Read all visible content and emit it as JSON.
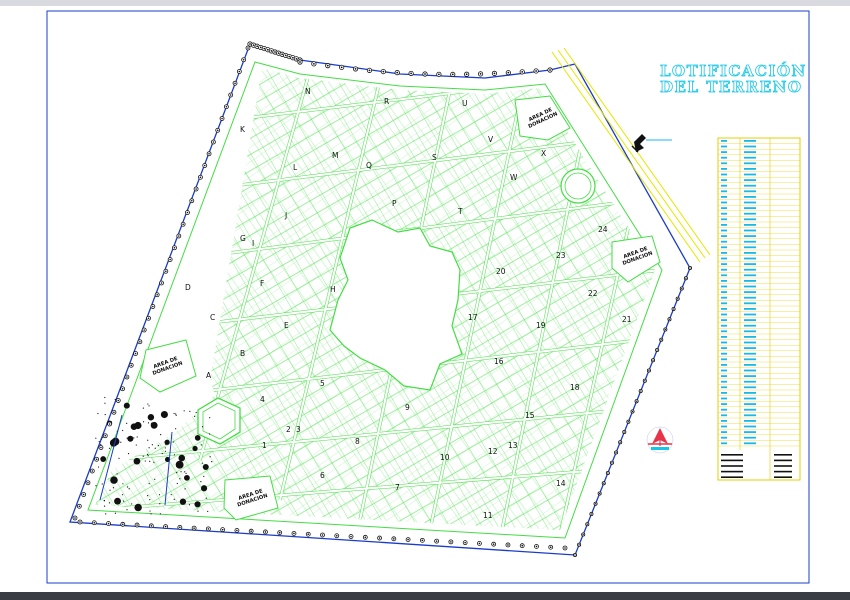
{
  "title": {
    "line1": "LOTIFICACIÓN",
    "line2": "DEL  TERRENO"
  },
  "donation_label": {
    "line1": "AREA DE",
    "line2": "DONACION"
  },
  "block_letters": [
    "K",
    "N",
    "R",
    "U",
    "L",
    "M",
    "Q",
    "S",
    "V",
    "W",
    "X",
    "J",
    "P",
    "T",
    "I",
    "G",
    "F",
    "H",
    "D",
    "C",
    "E",
    "B",
    "A"
  ],
  "block_numbers": [
    "24",
    "23",
    "22",
    "21",
    "20",
    "19",
    "18",
    "17",
    "16",
    "15",
    "14",
    "13",
    "12",
    "11",
    "10",
    "9",
    "8",
    "7",
    "6",
    "5",
    "4",
    "3",
    "2",
    "1"
  ],
  "colors": {
    "lot_lines": "#44dd44",
    "boundary": "#1a3cc8",
    "streets_text": "#18b8f0",
    "title": "#17c6e6",
    "table_frame": "#e2d000",
    "road": "#e6e600",
    "north_arrow": "#e8324a",
    "trees": "#111111"
  },
  "icons": [
    "north-arrow-icon",
    "parking-marker-icon",
    "tree-icon"
  ]
}
